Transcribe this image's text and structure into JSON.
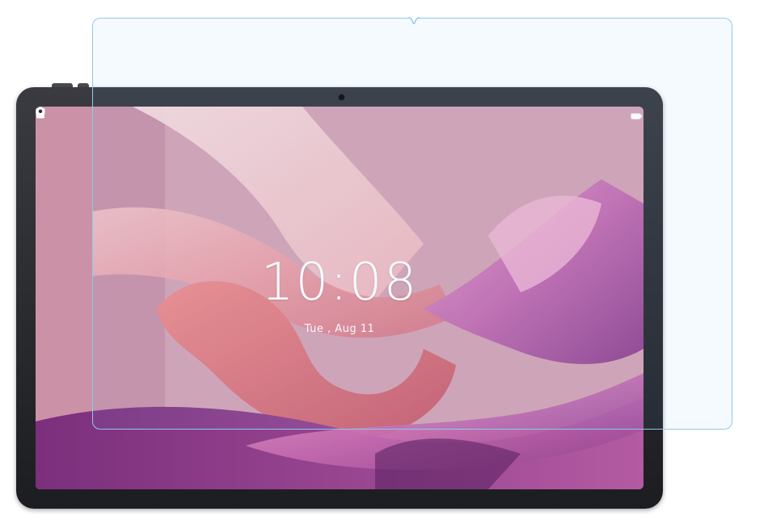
{
  "lock_screen": {
    "time": "10:08",
    "date": "Tue , Aug  11"
  },
  "icons": {
    "status_bar": [
      "wifi-icon",
      "battery-icon"
    ],
    "lock": "lock-icon",
    "camera_shortcut": "camera-icon"
  },
  "colors": {
    "protector_outline": "#8fc9ef",
    "tablet_bezel": "#2a2b30",
    "wallpaper_pink": "#e7a0ab",
    "wallpaper_magenta": "#b15a9f"
  }
}
